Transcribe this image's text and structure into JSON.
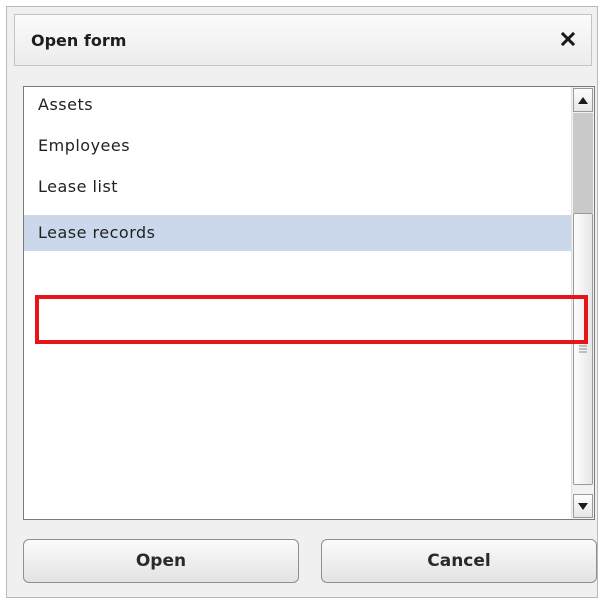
{
  "dialog": {
    "title": "Open form",
    "close_icon": "close-icon"
  },
  "list": {
    "items": [
      {
        "label": "Assets",
        "selected": false
      },
      {
        "label": "Employees",
        "selected": false
      },
      {
        "label": "Lease list",
        "selected": false
      },
      {
        "label": "Lease records",
        "selected": true
      }
    ],
    "highlight_color": "#e8141b",
    "selected_color": "#cbd8ec"
  },
  "buttons": {
    "open_label": "Open",
    "cancel_label": "Cancel"
  }
}
